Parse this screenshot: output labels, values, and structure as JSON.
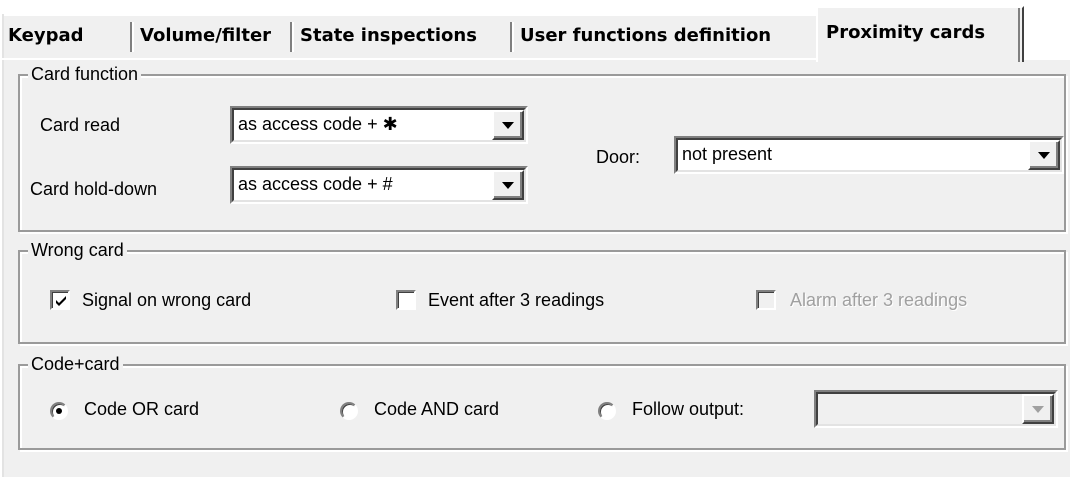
{
  "tabs": [
    {
      "label": "Keypad"
    },
    {
      "label": "Volume/filter"
    },
    {
      "label": "State inspections"
    },
    {
      "label": "User functions definition"
    },
    {
      "label": "Proximity cards",
      "active": true
    }
  ],
  "card_function": {
    "title": "Card function",
    "card_read_label": "Card read",
    "card_read_value": "as access code + ✱",
    "card_hold_label": "Card hold-down",
    "card_hold_value": "as access code + #",
    "door_label": "Door:",
    "door_value": "not present"
  },
  "wrong_card": {
    "title": "Wrong card",
    "signal_label": "Signal on wrong card",
    "signal_checked": true,
    "event_label": "Event after 3 readings",
    "event_checked": false,
    "alarm_label": "Alarm after 3 readings",
    "alarm_checked": false,
    "alarm_enabled": false
  },
  "code_card": {
    "title": "Code+card",
    "options": [
      "Code OR card",
      "Code AND card",
      "Follow output:"
    ],
    "selected": "Code OR card",
    "follow_output_value": ""
  }
}
